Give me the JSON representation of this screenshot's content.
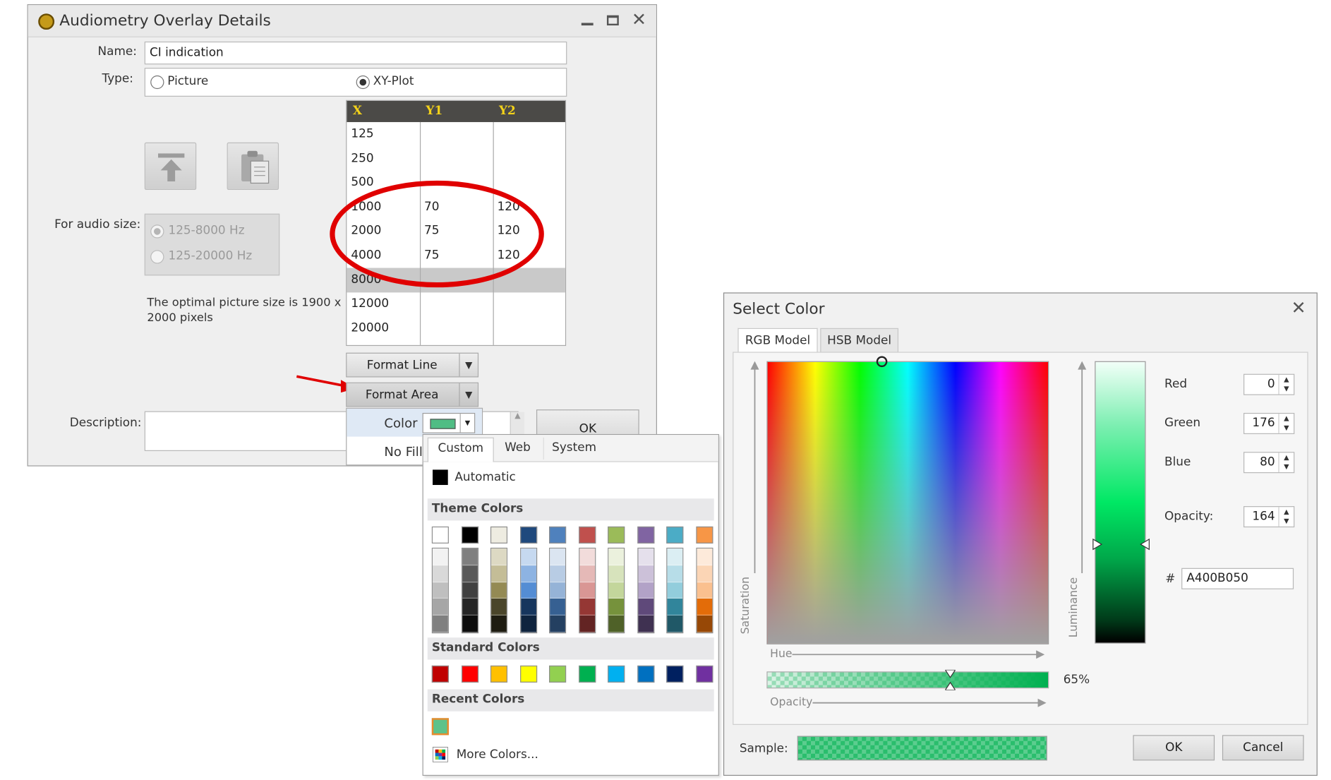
{
  "overlay_dialog": {
    "title": "Audiometry Overlay Details",
    "name_label": "Name:",
    "name_value": "CI indication",
    "type_label": "Type:",
    "type_options": [
      "Picture",
      "XY-Plot"
    ],
    "type_selected": "XY-Plot",
    "audio_size_label": "For audio size:",
    "audio_size_options": [
      "125-8000 Hz",
      "125-20000 Hz"
    ],
    "optimal_size_line1": "The optimal picture size is 1900 x",
    "optimal_size_line2": "2000 pixels",
    "description_label": "Description:",
    "ok_label": "OK",
    "table": {
      "columns": [
        "X",
        "Y1",
        "Y2"
      ],
      "rows": [
        [
          "125",
          "",
          ""
        ],
        [
          "250",
          "",
          ""
        ],
        [
          "500",
          "",
          ""
        ],
        [
          "1000",
          "70",
          "120"
        ],
        [
          "2000",
          "75",
          "120"
        ],
        [
          "4000",
          "75",
          "120"
        ],
        [
          "8000",
          "",
          ""
        ],
        [
          "12000",
          "",
          ""
        ],
        [
          "20000",
          "",
          ""
        ]
      ],
      "selected_row": "8000"
    },
    "format_line_label": "Format Line",
    "format_area_label": "Format Area"
  },
  "color_dropdown": {
    "color_label": "Color",
    "no_fill_label": "No Fill",
    "tabs": [
      "Custom",
      "Web",
      "System"
    ],
    "automatic_label": "Automatic",
    "theme_colors_title": "Theme Colors",
    "standard_colors_title": "Standard Colors",
    "recent_colors_title": "Recent Colors",
    "more_colors_label": "More Colors...",
    "theme_colors": [
      [
        "#ffffff",
        "#f2f2f2",
        "#d9d9d9",
        "#bfbfbf",
        "#a6a6a6",
        "#808080"
      ],
      [
        "#000000",
        "#7f7f7f",
        "#595959",
        "#404040",
        "#262626",
        "#0d0d0d"
      ],
      [
        "#eeece1",
        "#ddd9c3",
        "#c4bd97",
        "#948a54",
        "#4a452a",
        "#1e1c11"
      ],
      [
        "#1f497d",
        "#c6d9f0",
        "#8db3e2",
        "#548dd4",
        "#17365d",
        "#0f243e"
      ],
      [
        "#4f81bd",
        "#dbe5f1",
        "#b8cce4",
        "#95b3d7",
        "#366092",
        "#244061"
      ],
      [
        "#c0504d",
        "#f2dcdb",
        "#e5b9b7",
        "#d99694",
        "#953734",
        "#632423"
      ],
      [
        "#9bbb59",
        "#ebf1dd",
        "#d7e3bc",
        "#c3d69b",
        "#76923c",
        "#4f6128"
      ],
      [
        "#8064a2",
        "#e5e0ec",
        "#ccc1d9",
        "#b2a2c7",
        "#5f497a",
        "#3f3151"
      ],
      [
        "#4bacc6",
        "#dbeef3",
        "#b7dde8",
        "#92cddc",
        "#31859b",
        "#205867"
      ],
      [
        "#f79646",
        "#fdeada",
        "#fbd5b5",
        "#fac08f",
        "#e36c09",
        "#974806"
      ]
    ],
    "standard_colors": [
      "#c00000",
      "#ff0000",
      "#ffc000",
      "#ffff00",
      "#92d050",
      "#00b050",
      "#00b0f0",
      "#0070c0",
      "#002060",
      "#7030a0"
    ],
    "recent_colors": [
      "#5dc28a"
    ],
    "current_color": "#4fbd84"
  },
  "select_color_dialog": {
    "title": "Select Color",
    "tabs": [
      "RGB Model",
      "HSB Model"
    ],
    "active_tab": "RGB Model",
    "hue_label": "Hue",
    "saturation_label": "Saturation",
    "luminance_label": "Luminance",
    "opacity_axis_label": "Opacity",
    "opacity_percent": "65%",
    "opacity_fraction": 0.65,
    "red_label": "Red",
    "red_value": "0",
    "green_label": "Green",
    "green_value": "176",
    "blue_label": "Blue",
    "blue_value": "80",
    "opacity_label": "Opacity:",
    "opacity_value": "164",
    "hex_label": "#",
    "hex_value": "A400B050",
    "sample_label": "Sample:",
    "ok_label": "OK",
    "cancel_label": "Cancel",
    "accent_color": "#00b050"
  }
}
